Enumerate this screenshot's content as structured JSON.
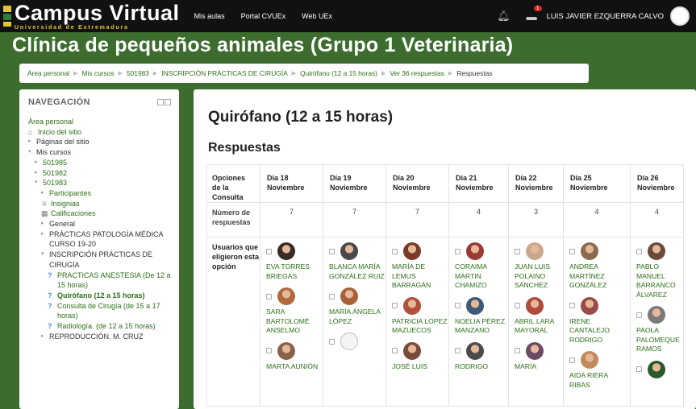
{
  "topbar": {
    "logo_title": "Campus Virtual",
    "logo_subtitle": "Universidad de Extremadura",
    "nav": [
      "Mis aulas",
      "Portal CVUEx",
      "Web UEx"
    ],
    "notifications_icon": "bell-icon",
    "messages_icon": "chat-icon",
    "messages_badge": "1",
    "user_name": "LUIS JAVIER EZQUERRA CALVO"
  },
  "course": {
    "title": "Clínica de pequeños animales (Grupo 1 Veterinaria)"
  },
  "breadcrumb": [
    "Área personal",
    "Mis cursos",
    "501983",
    "INSCRIPCIÓN PRÁCTICAS DE CIRUGÍA",
    "Quirófano (12 a 15 horas)",
    "Ver 36 respuestas",
    "Respuestas"
  ],
  "nav": {
    "title": "NAVEGACIÓN",
    "items": [
      {
        "label": "Área personal",
        "indent": 0,
        "arrow": "",
        "icon": "",
        "style": "g"
      },
      {
        "label": "Inicio del sitio",
        "indent": 0,
        "arrow": "",
        "icon": "⌂",
        "style": "g"
      },
      {
        "label": "Páginas del sitio",
        "indent": 0,
        "arrow": "▸",
        "icon": "",
        "style": "d"
      },
      {
        "label": "Mis cursos",
        "indent": 0,
        "arrow": "▾",
        "icon": "",
        "style": "d"
      },
      {
        "label": "501985",
        "indent": 1,
        "arrow": "▸",
        "icon": "",
        "style": "g"
      },
      {
        "label": "501982",
        "indent": 1,
        "arrow": "▸",
        "icon": "",
        "style": "g"
      },
      {
        "label": "501983",
        "indent": 1,
        "arrow": "▾",
        "icon": "",
        "style": "g"
      },
      {
        "label": "Participantes",
        "indent": 2,
        "arrow": "▸",
        "icon": "",
        "style": "g"
      },
      {
        "label": "Insignias",
        "indent": 2,
        "arrow": "",
        "icon": "🏆",
        "style": "g"
      },
      {
        "label": "Calificaciones",
        "indent": 2,
        "arrow": "",
        "icon": "▦",
        "style": "g"
      },
      {
        "label": "General",
        "indent": 2,
        "arrow": "▸",
        "icon": "",
        "style": "d"
      },
      {
        "label": "PRÁCTICAS PATOLOGÍA MÉDICA CURSO 19-20",
        "indent": 2,
        "arrow": "▸",
        "icon": "",
        "style": "d"
      },
      {
        "label": "INSCRIPCIÓN PRÁCTICAS DE CIRUGÍA",
        "indent": 2,
        "arrow": "▾",
        "icon": "",
        "style": "d"
      },
      {
        "label": "PRACTICAS ANESTESIA (De 12 a 15 horas)",
        "indent": 3,
        "arrow": "",
        "icon": "?",
        "style": "g"
      },
      {
        "label": "Quirófano (12 a 15 horas)",
        "indent": 3,
        "arrow": "",
        "icon": "?",
        "style": "gb"
      },
      {
        "label": "Consulta de Cirugía (de 15 a 17 horas)",
        "indent": 3,
        "arrow": "",
        "icon": "?",
        "style": "g"
      },
      {
        "label": "Radiología. (de 12 a 15 horas)",
        "indent": 3,
        "arrow": "",
        "icon": "?",
        "style": "g"
      },
      {
        "label": "REPRODUCCIÓN. M. CRUZ",
        "indent": 2,
        "arrow": "▸",
        "icon": "",
        "style": "d"
      }
    ]
  },
  "main": {
    "heading": "Quirófano (12 a 15 horas)",
    "subheading": "Respuestas",
    "row_labels": {
      "options": "Opciones de la Consulta",
      "count": "Número de respuestas",
      "users": "Usuarios que eligieron esta opción"
    },
    "columns": [
      {
        "label": "Día 18 Noviembre",
        "count": "7",
        "users": [
          {
            "name": "EVA TORRES BRIEGAS",
            "color": "#3a2a24"
          },
          {
            "name": "SARA BARTOLOMÉ ANSELMO",
            "color": "#b06a3e"
          },
          {
            "name": "MARTA AUNIÓN",
            "color": "#8a6248"
          }
        ]
      },
      {
        "label": "Día 19 Noviembre",
        "count": "7",
        "users": [
          {
            "name": "BLANCA MARÍA GONZÁLEZ RUIZ",
            "color": "#4a4a4a"
          },
          {
            "name": "MARÍA ÁNGELA LÓPEZ",
            "color": "#a8603a"
          },
          {
            "name": "",
            "color": "#eeeeee"
          }
        ]
      },
      {
        "label": "Día 20 Noviembre",
        "count": "7",
        "users": [
          {
            "name": "MARÍA DE LEMUS BARRAGÁN",
            "color": "#7a3a28"
          },
          {
            "name": "PATRICIA LOPEZ MAZUECOS",
            "color": "#b0503a"
          },
          {
            "name": "JOSÉ LUIS",
            "color": "#7a4a3a"
          }
        ]
      },
      {
        "label": "Día 21 Noviembre",
        "count": "4",
        "users": [
          {
            "name": "CORAIMA MARTIN CHAMIZO",
            "color": "#9a3a34"
          },
          {
            "name": "NOELIA PÉREZ MANZANO",
            "color": "#3c5a78"
          },
          {
            "name": "RODRIGO",
            "color": "#4a4a4a"
          }
        ]
      },
      {
        "label": "Día 22 Noviembre",
        "count": "3",
        "users": [
          {
            "name": "JUAN LUIS POLAINO SÁNCHEZ",
            "color": "#c8a890"
          },
          {
            "name": "ABRIL LARA MAYORAL",
            "color": "#b04a3a"
          },
          {
            "name": "MARÍA",
            "color": "#6a4a64"
          }
        ]
      },
      {
        "label": "Día 25 Noviembre",
        "count": "4",
        "users": [
          {
            "name": "ANDREA MARTÍNEZ GONZÁLEZ",
            "color": "#8a6a4e"
          },
          {
            "name": "IRENE CANTALEJO RODRIGO",
            "color": "#9a4a4a"
          },
          {
            "name": "AIDA RIERA RIBAS",
            "color": "#c08a5a"
          }
        ]
      },
      {
        "label": "Día 26 Noviembre",
        "count": "4",
        "users": [
          {
            "name": "PABLO MANUEL BARRANCO ÁLVAREZ",
            "color": "#6a4a3a"
          },
          {
            "name": "PAOLA PALOMEQUE RAMOS",
            "color": "#7a7a7a"
          },
          {
            "name": "",
            "color": "#2a5a2a"
          }
        ]
      }
    ]
  },
  "colors": {
    "brand_green": "#3c6d2e",
    "link_green": "#2b6f17",
    "topbar": "#111111",
    "logo_accent": "#e2c531"
  }
}
